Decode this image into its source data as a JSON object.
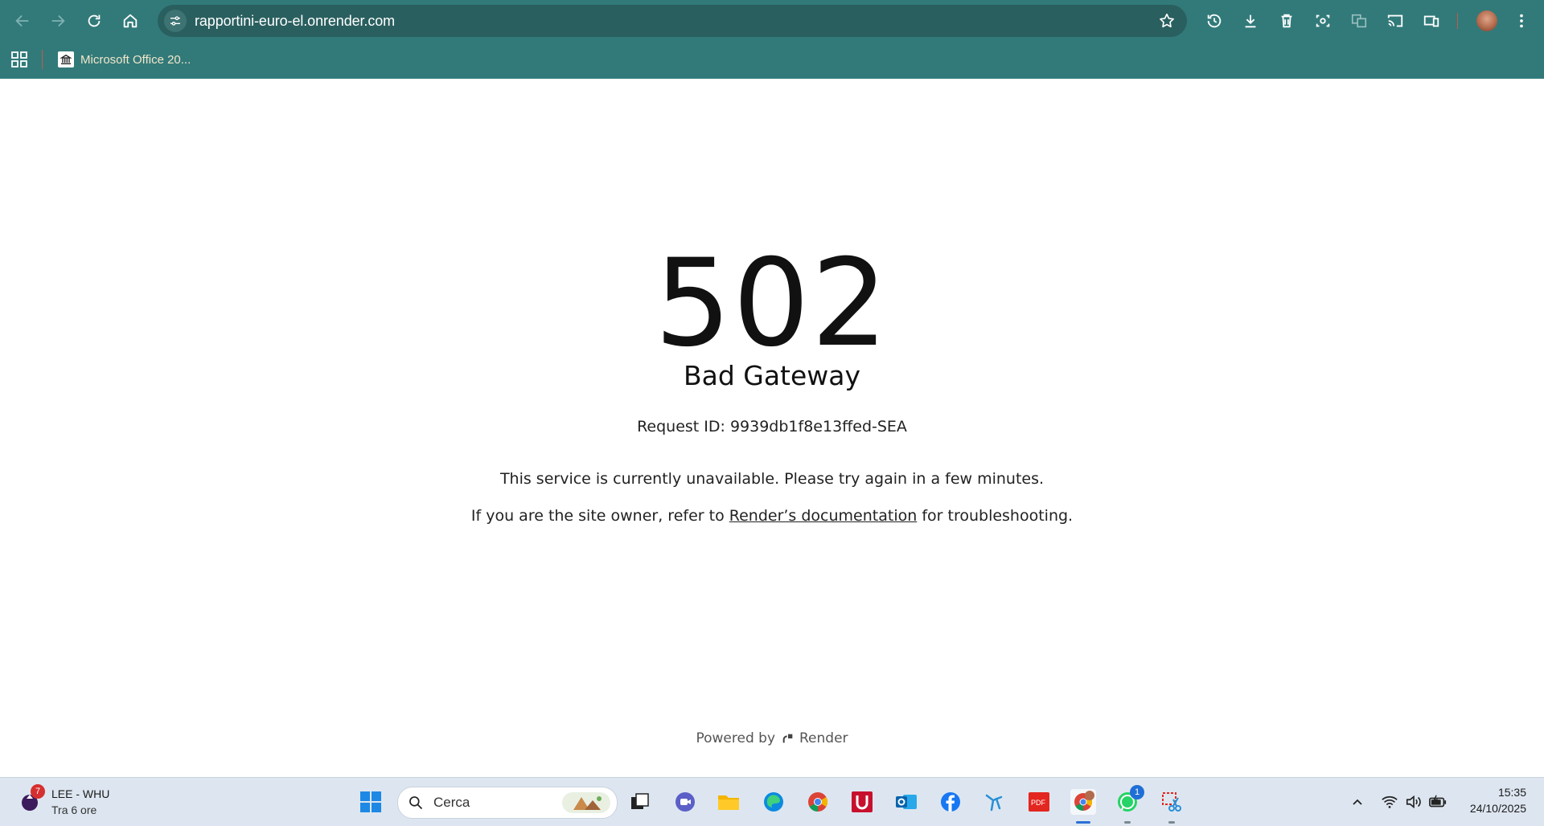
{
  "browser": {
    "url": "rapportini-euro-el.onrender.com",
    "bookmarks": [
      {
        "label": "Microsoft Office 20..."
      }
    ]
  },
  "page": {
    "code": "502",
    "reason": "Bad Gateway",
    "request_id": "Request ID: 9939db1f8e13ffed-SEA",
    "message": "This service is currently unavailable. Please try again in a few minutes.",
    "owner_prefix": "If you are the site owner, refer to",
    "owner_link": "Render’s documentation",
    "owner_suffix": "for troubleshooting.",
    "powered_by": "Powered by",
    "brand": "Render"
  },
  "taskbar": {
    "weather": {
      "title": "LEE - WHU",
      "subtitle": "Tra 6 ore",
      "badge": "7"
    },
    "search_placeholder": "Cerca",
    "whatsapp_badge": "1",
    "time": "15:35",
    "date": "24/10/2025"
  },
  "colors": {
    "chrome": "#327a7a",
    "omnibox": "#2a5f5f",
    "taskbar": "#dde6f0"
  }
}
